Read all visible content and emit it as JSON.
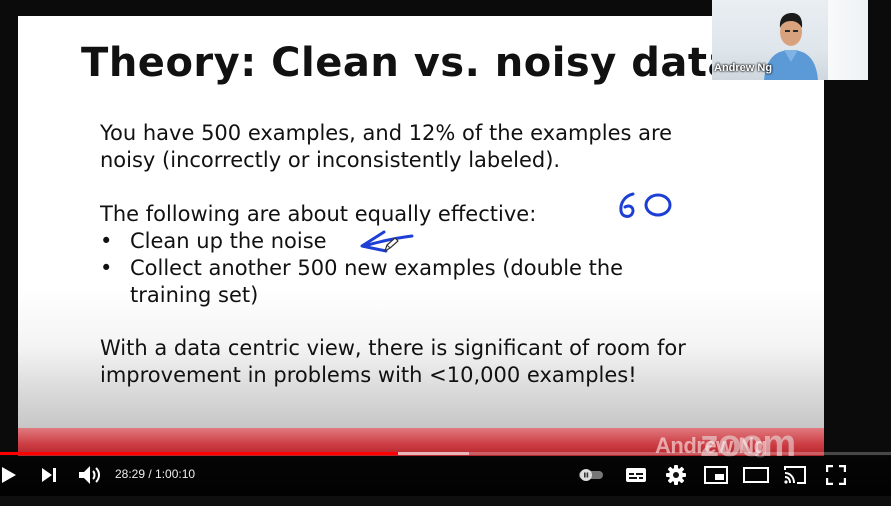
{
  "slide": {
    "title": "Theory: Clean vs. noisy data",
    "para1_line1": "You have 500 examples, and 12% of the examples are",
    "para1_line2": "noisy (incorrectly or inconsistently labeled).",
    "lead": "The following are about equally effective:",
    "bullet1": "Clean up the noise",
    "bullet2_line1": "Collect another 500 new examples (double the",
    "bullet2_line2": "training set)",
    "para3_line1": "With a data centric view, there is significant of room for",
    "para3_line2": "improvement in problems with <10,000 examples!",
    "handwritten_note": "60",
    "ink_color": "#1d3fd6",
    "band_color": "#cc3b42"
  },
  "webcam": {
    "name": "Andrew Ng"
  },
  "watermark": {
    "speaker": "Andrew Ng",
    "logo": "zoom"
  },
  "player": {
    "current_time": "28:29",
    "duration": "1:00:10",
    "time_display": "28:29 / 1:00:10",
    "progress_fraction": 0.447,
    "buffered_fraction": 0.526,
    "accent_color": "#ff0000",
    "icons": [
      "play-icon",
      "next-icon",
      "volume-icon",
      "autoplay-toggle-icon",
      "subtitles-icon",
      "settings-icon",
      "miniplayer-icon",
      "theater-icon",
      "cast-icon",
      "fullscreen-icon"
    ]
  }
}
